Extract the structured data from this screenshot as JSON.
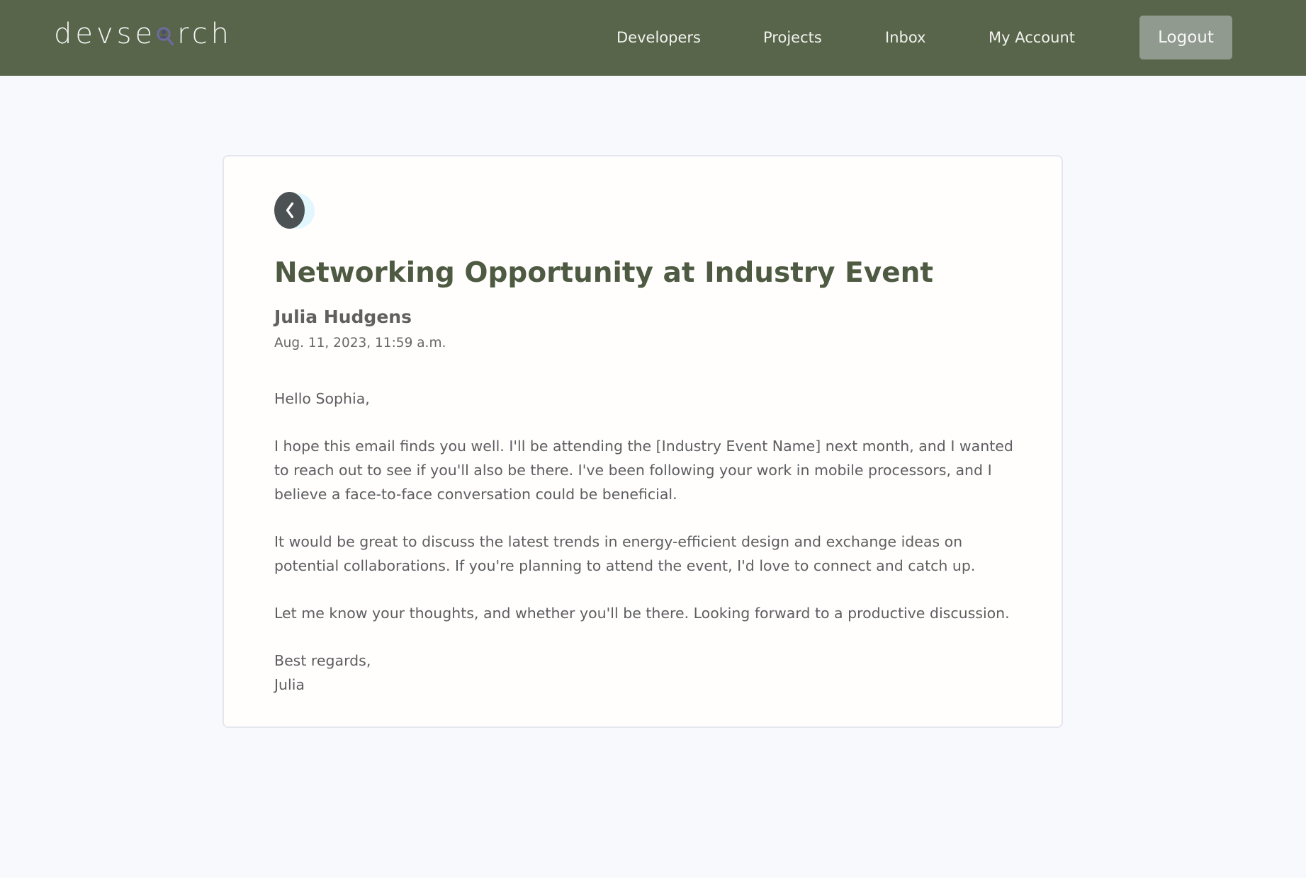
{
  "header": {
    "logo_text_before": "devse",
    "logo_text_after": "rch",
    "logo_icon": "magnifier-person-icon",
    "nav": [
      {
        "label": "Developers"
      },
      {
        "label": "Projects"
      },
      {
        "label": "Inbox"
      },
      {
        "label": "My Account"
      }
    ],
    "logout_label": "Logout"
  },
  "message": {
    "back_icon": "chevron-left-icon",
    "title": "Networking Opportunity at Industry Event",
    "sender": "Julia Hudgens",
    "sent_at": "Aug. 11, 2023, 11:59 a.m.",
    "body": {
      "greeting": "Hello Sophia,",
      "paragraph_1": "I hope this email finds you well. I'll be attending the [Industry Event Name] next month, and I wanted to reach out to see if you'll also be there. I've been following your work in mobile processors, and I believe a face-to-face conversation could be beneficial.",
      "paragraph_2": "It would be great to discuss the latest trends in energy-efficient design and exchange ideas on potential collaborations. If you're planning to attend the event, I'd love to connect and catch up.",
      "paragraph_3": "Let me know your thoughts, and whether you'll be there. Looking forward to a productive discussion.",
      "closing": "Best regards,",
      "signature": "Julia"
    }
  },
  "colors": {
    "header_bg": "#58654a",
    "page_bg": "#f8f9fc",
    "card_bg": "#fffefc",
    "title": "#4e5a42",
    "logout_bg": "#909a8e",
    "back_button": "#4c5254",
    "back_halo": "#e2f6fd",
    "logo_accent": "#6e6a9d"
  }
}
